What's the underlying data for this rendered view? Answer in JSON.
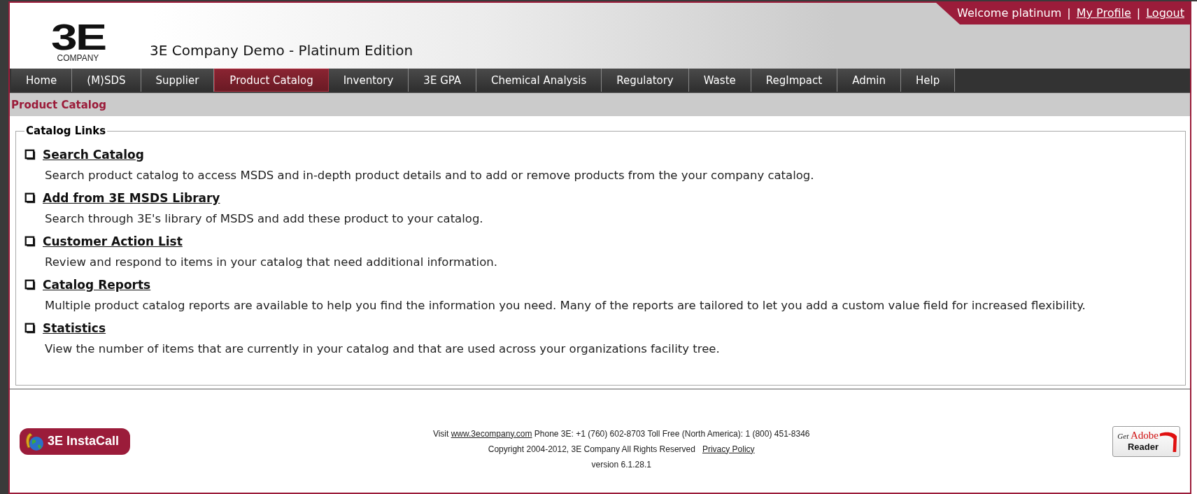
{
  "header": {
    "logo_mark": "3E",
    "logo_word": "COMPANY",
    "title": "3E Company Demo - Platinum Edition",
    "welcome": "Welcome platinum",
    "separator": "|",
    "user_links": [
      "My Profile",
      "Logout"
    ]
  },
  "nav": [
    {
      "label": "Home",
      "selected": false
    },
    {
      "label": "(M)SDS",
      "selected": false
    },
    {
      "label": "Supplier",
      "selected": false
    },
    {
      "label": "Product Catalog",
      "selected": true
    },
    {
      "label": "Inventory",
      "selected": false
    },
    {
      "label": "3E GPA",
      "selected": false
    },
    {
      "label": "Chemical Analysis",
      "selected": false
    },
    {
      "label": "Regulatory",
      "selected": false
    },
    {
      "label": "Waste",
      "selected": false
    },
    {
      "label": "RegImpact",
      "selected": false
    },
    {
      "label": "Admin",
      "selected": false
    },
    {
      "label": "Help",
      "selected": false
    }
  ],
  "breadcrumb": "Product Catalog",
  "catalog_links": {
    "legend": "Catalog Links",
    "items": [
      {
        "title": "Search Catalog",
        "description": "Search product catalog to access MSDS and in-depth product details and to add or remove products from the your company catalog."
      },
      {
        "title": "Add from 3E MSDS Library",
        "description": "Search through 3E's library of MSDS and add these product to your catalog."
      },
      {
        "title": "Customer Action List",
        "description": "Review and respond to items in your catalog that need additional information."
      },
      {
        "title": "Catalog Reports",
        "description": "Multiple product catalog reports are available to help you find the information you need. Many of the reports are tailored to let you add a custom value field for increased flexibility."
      },
      {
        "title": "Statistics",
        "description": "View the number of items that are currently in your catalog and that are used across your organizations facility tree."
      }
    ]
  },
  "footer": {
    "instacall": "3E InstaCall",
    "visit": "Visit",
    "website": "www.3ecompany.com",
    "phone": "Phone 3E: +1 (760) 602-8703 Toll Free (North America): 1 (800) 451-8346",
    "copyright": "Copyright 2004-2012, 3E Company All Rights Reserved",
    "privacy": "Privacy Policy",
    "version": "version 6.1.28.1",
    "adobe_get": "Get",
    "adobe_brand": "Adobe",
    "adobe_reader": "Reader"
  }
}
